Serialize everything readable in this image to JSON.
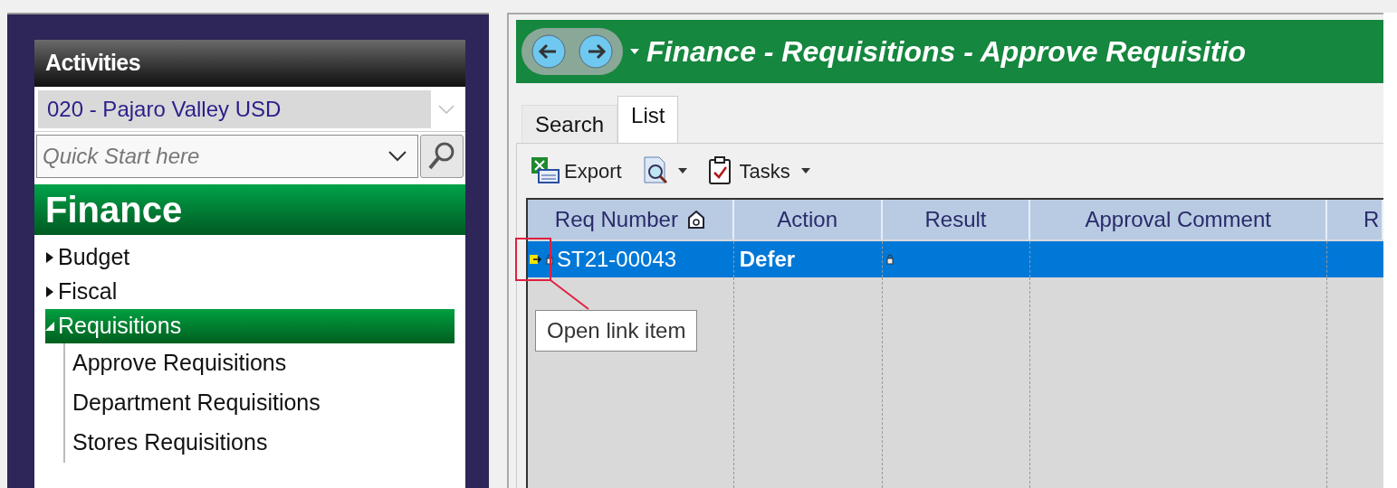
{
  "activities": {
    "title": "Activities",
    "district": "020 - Pajaro Valley USD",
    "quick_start": {
      "placeholder": "Quick Start here"
    },
    "module": "Finance",
    "tree": [
      {
        "label": "Budget",
        "expanded": false,
        "selected": false
      },
      {
        "label": "Fiscal",
        "expanded": false,
        "selected": false
      },
      {
        "label": "Requisitions",
        "expanded": true,
        "selected": true,
        "children": [
          {
            "label": "Approve Requisitions"
          },
          {
            "label": "Department Requisitions"
          },
          {
            "label": "Stores Requisitions"
          }
        ]
      }
    ]
  },
  "main": {
    "title": "Finance - Requisitions - Approve Requisitio",
    "tabs": [
      {
        "label": "Search",
        "selected": false
      },
      {
        "label": "List",
        "selected": true
      }
    ],
    "toolbar": [
      {
        "kind": "export",
        "label": "Export"
      },
      {
        "kind": "preview"
      },
      {
        "kind": "tasks",
        "label": "Tasks"
      }
    ],
    "columns": [
      "Req Number",
      "Action",
      "Result",
      "Approval Comment",
      "R"
    ],
    "rows": [
      {
        "req_number": "ST21-00043",
        "action": "Defer",
        "selected": true
      }
    ],
    "tooltip": "Open link item"
  }
}
